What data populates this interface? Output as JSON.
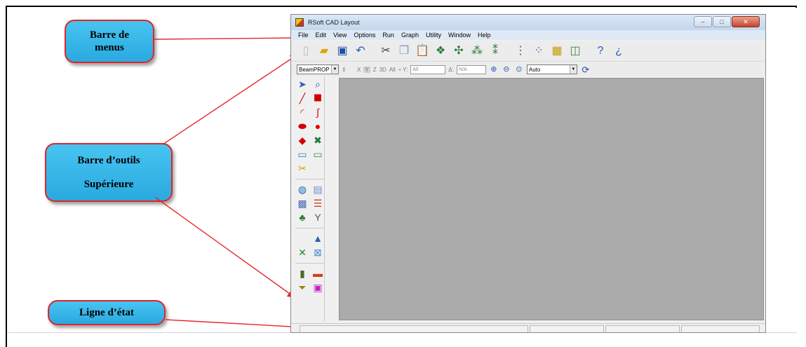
{
  "callouts": {
    "menus": [
      "Barre de",
      "menus"
    ],
    "toolbar": [
      "Barre d’outils",
      "Supérieure"
    ],
    "status": "Ligne d’état"
  },
  "window": {
    "title": "RSoft CAD Layout",
    "controls": {
      "minimize": "–",
      "maximize": "□",
      "close": "✕"
    }
  },
  "menu": [
    "File",
    "Edit",
    "View",
    "Options",
    "Run",
    "Graph",
    "Utility",
    "Window",
    "Help"
  ],
  "toolbar_icons": [
    "new-file-icon",
    "open-folder-icon",
    "save-icon",
    "undo-icon",
    "cut-icon",
    "copy-icon",
    "paste-icon",
    "group-icon",
    "ungroup-icon",
    "link-icon",
    "unlink-icon",
    "array-icon",
    "grid-icon",
    "table-icon",
    "window-icon",
    "help-icon",
    "context-help-icon"
  ],
  "toolbar2": {
    "simulator": "BeamPROP",
    "x_label": "X",
    "y_label": "Y",
    "z_label": "Z",
    "view_3d": "3D",
    "all_label": "All",
    "y_field": "All",
    "delta_field": "N/A",
    "zoom_select": "Auto"
  },
  "tools": [
    "select-arrow-icon",
    "zoom-icon",
    "line-segment-icon",
    "taper-icon",
    "arc-icon",
    "s-bend-icon",
    "ellipse-icon",
    "sphere-icon",
    "polygon-icon",
    "crossing-icon",
    "fiber-icon",
    "port-icon",
    "scissors-icon",
    "globe-icon",
    "document-icon",
    "grid-pattern-icon",
    "color-bars-icon",
    "tree-icon",
    "splitter-icon",
    "rocket-icon",
    "x-coupler-icon",
    "mesh-icon",
    "tower-icon",
    "index-profile-icon",
    "funnel-icon",
    "view-icon"
  ]
}
